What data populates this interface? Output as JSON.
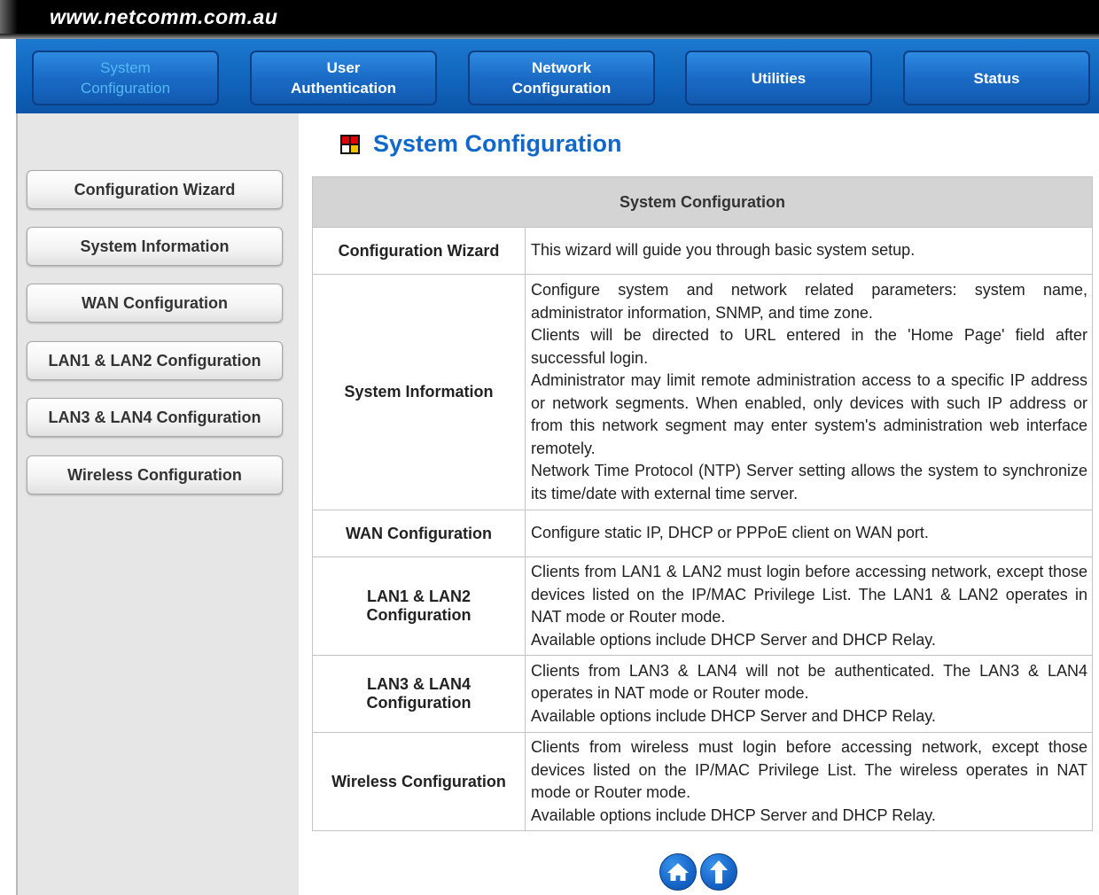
{
  "header": {
    "site_url": "www.netcomm.com.au"
  },
  "nav": {
    "items": [
      {
        "line1": "System",
        "line2": "Configuration",
        "active": true
      },
      {
        "line1": "User",
        "line2": "Authentication",
        "active": false
      },
      {
        "line1": "Network",
        "line2": "Configuration",
        "active": false
      },
      {
        "line1": "Utilities",
        "line2": "",
        "active": false
      },
      {
        "line1": "Status",
        "line2": "",
        "active": false
      }
    ]
  },
  "sidebar": {
    "items": [
      {
        "label": "Configuration Wizard"
      },
      {
        "label": "System Information"
      },
      {
        "label": "WAN Configuration"
      },
      {
        "label": "LAN1 & LAN2 Configuration"
      },
      {
        "label": "LAN3 & LAN4 Configuration"
      },
      {
        "label": "Wireless Configuration"
      }
    ]
  },
  "page": {
    "title": "System Configuration",
    "title_icon": "window-grid-icon"
  },
  "table": {
    "header": "System Configuration",
    "rows": [
      {
        "label": "Configuration Wizard",
        "desc": [
          "This wizard will guide you through basic system setup."
        ]
      },
      {
        "label": "System Information",
        "desc": [
          "Configure system and network related parameters: system name, administrator information, SNMP, and time zone.",
          "Clients will be directed to URL entered in the 'Home Page' field after successful login.",
          "Administrator may limit remote administration access to a specific IP address or network segments. When enabled, only devices with such IP address or from this network segment may enter system's administration web interface remotely.",
          "Network Time Protocol (NTP) Server setting allows the system to synchronize its time/date with external time server."
        ]
      },
      {
        "label": "WAN Configuration",
        "desc": [
          "Configure static IP, DHCP or PPPoE client on WAN port."
        ]
      },
      {
        "label": "LAN1 & LAN2 Configuration",
        "desc": [
          "Clients from LAN1 & LAN2 must login before accessing network, except those devices listed on the IP/MAC Privilege List. The LAN1 & LAN2 operates in NAT mode or Router mode.",
          "Available options include DHCP Server and DHCP Relay."
        ]
      },
      {
        "label": "LAN3 & LAN4 Configuration",
        "desc": [
          "Clients from LAN3 & LAN4 will not be authenticated. The LAN3 & LAN4 operates in NAT mode or Router mode.",
          "Available options include DHCP Server and DHCP Relay."
        ]
      },
      {
        "label": "Wireless Configuration",
        "desc": [
          "Clients from wireless must login before accessing network, except those devices listed on the IP/MAC Privilege List. The wireless operates in NAT mode or Router mode.",
          "Available options include DHCP Server and DHCP Relay."
        ]
      }
    ]
  },
  "footer": {
    "icons": [
      "home-icon",
      "up-arrow-icon"
    ]
  },
  "colors": {
    "nav_blue": "#1165bc",
    "active_nav_text": "#55b8f5",
    "title_blue": "#1069c9",
    "sidebar_bg": "#e6e6e6",
    "table_header_bg": "#d4d4d4"
  }
}
